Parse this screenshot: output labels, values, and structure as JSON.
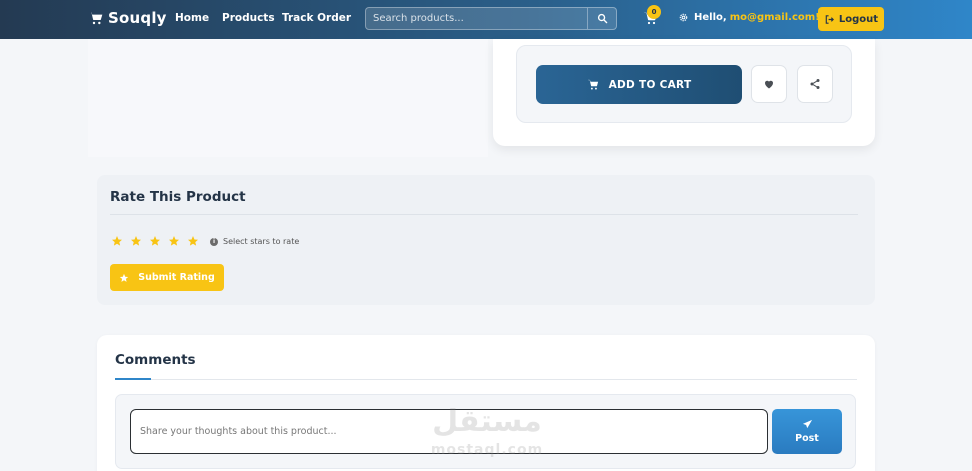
{
  "navbar": {
    "brand": "Souqly",
    "links": [
      "Home",
      "Products",
      "Track Order"
    ],
    "search_placeholder": "Search products...",
    "cart_count": "0",
    "greeting": "Hello,",
    "email": "mo@gmail.com!",
    "logout_label": "Logout"
  },
  "product": {
    "add_to_cart_label": "ADD TO CART",
    "wishlist_icon": "heart-icon",
    "share_icon": "share-icon"
  },
  "rating": {
    "title": "Rate This Product",
    "star_count": 5,
    "hint": "Select stars to rate",
    "submit_label": "Submit Rating"
  },
  "comments": {
    "title": "Comments",
    "input_placeholder": "Share your thoughts about this product...",
    "post_label": "Post"
  },
  "watermark": {
    "arabic": "مستقل",
    "latin": "mostaql.com"
  },
  "colors": {
    "brand_yellow": "#f8c414",
    "primary_blue": "#2a6595",
    "navbar_start": "#243a52",
    "navbar_end": "#2f86c9"
  }
}
